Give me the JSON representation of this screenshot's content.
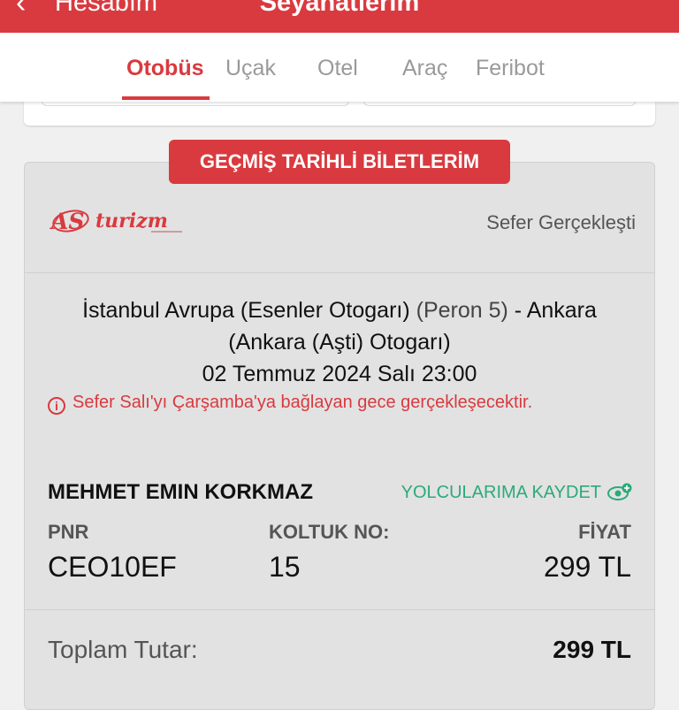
{
  "header": {
    "back_label": "Hesabım",
    "title": "Seyahatlerim",
    "background_color": "#d93a3f"
  },
  "tabs": [
    {
      "label": "Otobüs",
      "active": true
    },
    {
      "label": "Uçak",
      "active": false
    },
    {
      "label": "Otel",
      "active": false
    },
    {
      "label": "Araç",
      "active": false
    },
    {
      "label": "Feribot",
      "active": false
    }
  ],
  "section": {
    "title": "GEÇMİŞ TARİHLİ BİLETLERİM"
  },
  "ticket": {
    "company_logo": "AS turizm",
    "status": "Sefer Gerçekleşti",
    "route_from": "İstanbul Avrupa (Esenler Otogarı)",
    "route_platform": "(Peron 5)",
    "route_to": "- Ankara",
    "route_to_detail": "(Ankara (Aşti) Otogarı)",
    "datetime": "02 Temmuz 2024 Salı 23:00",
    "warning": "Sefer Salı'yı Çarşamba'ya bağlayan gece gerçekleşecektir.",
    "passenger_name": "MEHMET EMIN KORKMAZ",
    "save_passenger_label": "YOLCULARIMA KAYDET",
    "columns": {
      "pnr_label": "PNR",
      "seat_label": "KOLTUK NO:",
      "price_label": "FİYAT"
    },
    "values": {
      "pnr": "CEO10EF",
      "seat": "15",
      "price": "299 TL"
    },
    "total_label": "Toplam Tutar:",
    "total_value": "299 TL"
  },
  "colors": {
    "accent": "#d93a3f",
    "save_link": "#2baa7a",
    "card_bg": "#e2e2e2"
  }
}
